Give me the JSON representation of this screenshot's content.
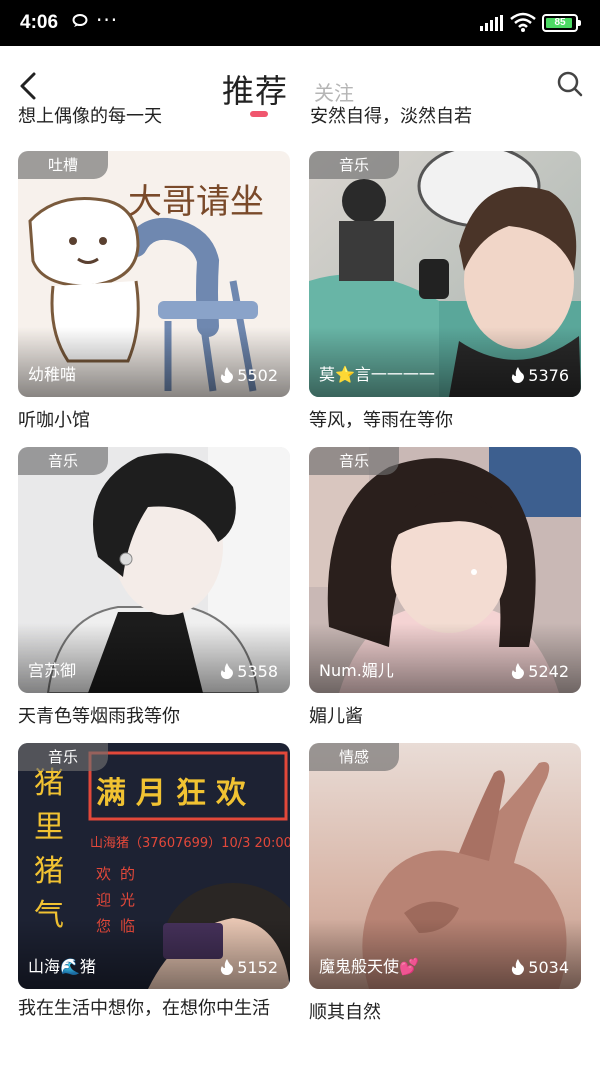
{
  "status_bar": {
    "time": "4:06",
    "battery": "85",
    "icons": [
      "message-icon",
      "more-dots-icon",
      "signal-icon",
      "wifi-icon",
      "battery-icon"
    ]
  },
  "nav": {
    "tab_recommend": "推荐",
    "tab_follow": "关注",
    "accent": "#f0566e"
  },
  "partial_titles": [
    "想上偶像的每一天",
    "安然自得，淡然自若"
  ],
  "cards": [
    {
      "tag": "吐槽",
      "author": "幼稚喵",
      "heat": "5502",
      "title": "听咖小馆",
      "art_text": "大哥请坐"
    },
    {
      "tag": "音乐",
      "author": "莫⭐言一一一一",
      "heat": "5376",
      "title": "等风，等雨在等你"
    },
    {
      "tag": "音乐",
      "author": "宫苏御",
      "heat": "5358",
      "title": "天青色等烟雨我等你"
    },
    {
      "tag": "音乐",
      "author": "Num.媚儿",
      "heat": "5242",
      "title": "媚儿酱"
    },
    {
      "tag": "音乐",
      "author": "山海🌊猪",
      "heat": "5152",
      "title": "我在生活中想你，在想你中生活",
      "art_banner": "满月狂欢",
      "art_side": [
        "猪",
        "里",
        "猪",
        "气"
      ],
      "art_info": "山海猪（37607699）10/3 20:00",
      "art_poem": [
        "欢",
        "的",
        "迎",
        "光",
        "您",
        "临"
      ]
    },
    {
      "tag": "情感",
      "author": "魔鬼般天使💕",
      "heat": "5034",
      "title": "顺其自然"
    }
  ]
}
